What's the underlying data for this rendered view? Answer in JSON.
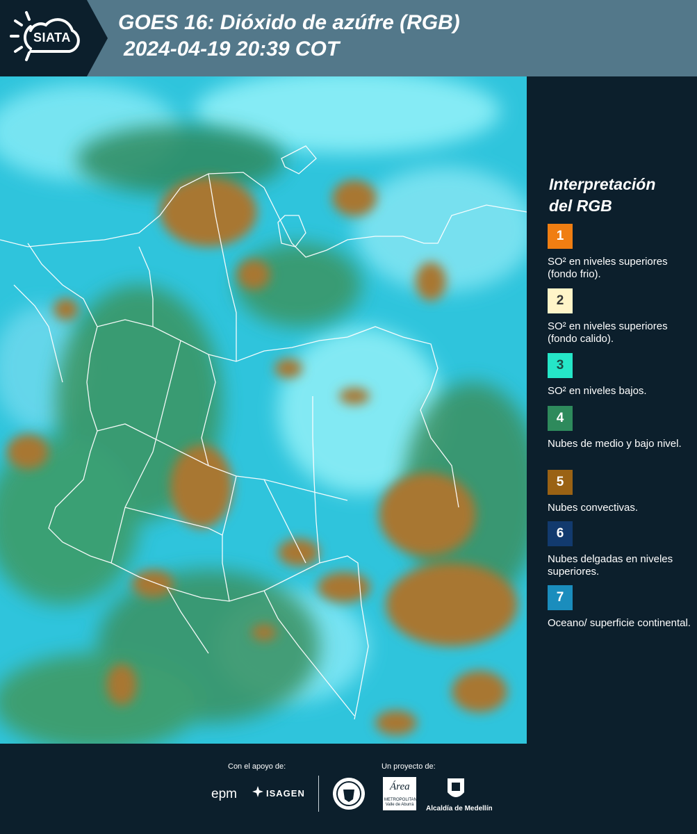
{
  "header": {
    "logo_text": "SIATA",
    "title_line1": "GOES 16: Dióxido de azúfre (RGB)",
    "title_line2": "2024-04-19 20:39 COT"
  },
  "legend": {
    "title_line1": "Interpretación",
    "title_line2": "del RGB",
    "items": [
      {
        "number": "1",
        "label": "SO² en niveles superiores (fondo frio).",
        "color": "#f07e12",
        "text_color": "#ffffff"
      },
      {
        "number": "2",
        "label": "SO² en niveles superiores (fondo calido).",
        "color": "#fff4c8",
        "text_color": "#333333"
      },
      {
        "number": "3",
        "label": "SO² en niveles bajos.",
        "color": "#25e6c8",
        "text_color": "#1a4a44"
      },
      {
        "number": "4",
        "label": "Nubes de medio y bajo nivel.",
        "color": "#2e8a5c",
        "text_color": "#ffffff"
      },
      {
        "number": "5",
        "label": "Nubes convectivas.",
        "color": "#9a6214",
        "text_color": "#ffffff"
      },
      {
        "number": "6",
        "label": "Nubes delgadas en niveles superiores.",
        "color": "#123a6e",
        "text_color": "#ffffff"
      },
      {
        "number": "7",
        "label": "Oceano/ superficie continental.",
        "color": "#1a8dbd",
        "text_color": "#ffffff"
      }
    ]
  },
  "footer": {
    "support_label": "Con el apoyo de:",
    "project_label": "Un proyecto de:",
    "brand_epm": "epm",
    "brand_isagen": "ISAGEN",
    "brand_area": "Área",
    "brand_area_sub": "METROPOLITANA Valle de Aburrá",
    "brand_alcaldia": "Alcaldía de Medellín"
  }
}
